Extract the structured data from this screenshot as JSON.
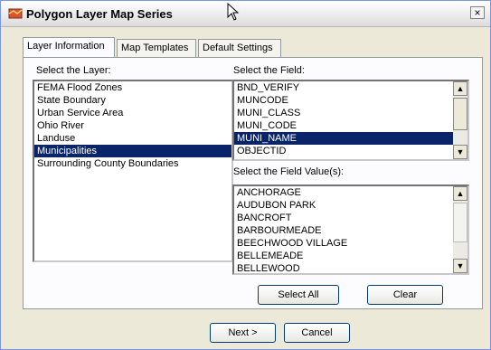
{
  "window": {
    "title": "Polygon Layer Map Series",
    "close_glyph": "×",
    "icon": "map-layer-icon",
    "accent": "#0a246a"
  },
  "tabs": [
    {
      "label": "Layer Information",
      "active": true
    },
    {
      "label": "Map Templates",
      "active": false
    },
    {
      "label": "Default Settings",
      "active": false
    }
  ],
  "layer": {
    "label": "Select the Layer:",
    "items": [
      "FEMA Flood Zones",
      "State Boundary",
      "Urban Service Area",
      "Ohio River",
      "Landuse",
      "Municipalities",
      "Surrounding County Boundaries"
    ],
    "selected_index": 5
  },
  "field": {
    "label": "Select the Field:",
    "items": [
      "BND_VERIFY",
      "MUNCODE",
      "MUNI_CLASS",
      "MUNI_CODE",
      "MUNI_NAME",
      "OBJECTID"
    ],
    "selected_index": 4
  },
  "field_values": {
    "label": "Select the Field Value(s):",
    "items": [
      "ANCHORAGE",
      "AUDUBON PARK",
      "BANCROFT",
      "BARBOURMEADE",
      "BEECHWOOD VILLAGE",
      "BELLEMEADE",
      "BELLEWOOD"
    ]
  },
  "buttons": {
    "select_all": "Select All",
    "clear": "Clear",
    "next": "Next >",
    "cancel": "Cancel"
  }
}
